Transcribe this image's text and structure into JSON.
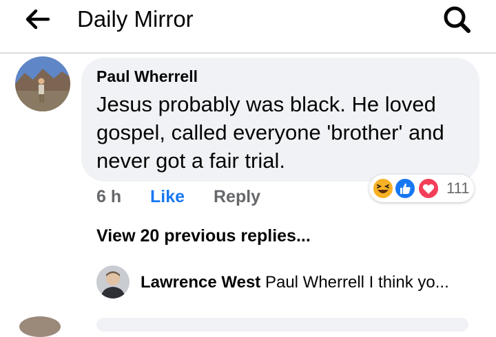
{
  "header": {
    "title": "Daily Mirror",
    "back_icon": "arrow-left-icon",
    "search_icon": "search-icon"
  },
  "comment": {
    "author": "Paul Wherrell",
    "text": "Jesus probably was black. He loved gospel, called everyone 'brother' and never got a fair trial.",
    "time": "6 h",
    "like_label": "Like",
    "reply_label": "Reply",
    "reactions": {
      "icons": [
        "haha-icon",
        "like-icon",
        "love-icon"
      ],
      "count": "111"
    }
  },
  "replies": {
    "view_previous_label": "View 20 previous replies...",
    "latest": {
      "author": "Lawrence West",
      "text": "Paul Wherrell I think yo..."
    }
  },
  "colors": {
    "like_blue": "#1877f2",
    "bubble_gray": "#f0f2f5",
    "meta_gray": "#65676b",
    "love_red": "#f33e58",
    "haha_yellow": "#f7b125"
  }
}
